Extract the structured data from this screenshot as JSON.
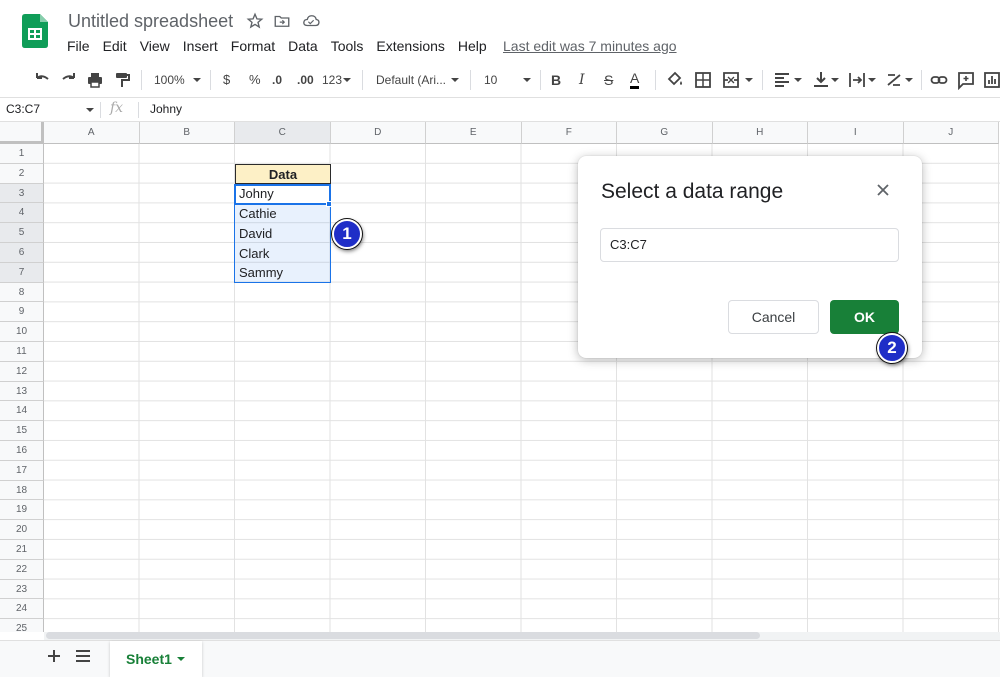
{
  "doc": {
    "title": "Untitled spreadsheet",
    "last_edit": "Last edit was 7 minutes ago"
  },
  "menu": [
    "File",
    "Edit",
    "View",
    "Insert",
    "Format",
    "Data",
    "Tools",
    "Extensions",
    "Help"
  ],
  "toolbar": {
    "zoom": "100%",
    "currency": "$",
    "percent": "%",
    "dec_decrease": ".0",
    "dec_increase": ".00",
    "more_formats": "123",
    "font": "Default (Ari...",
    "font_size": "10",
    "bold": "B",
    "italic": "I",
    "strike": "S",
    "text_color": "A"
  },
  "formula_bar": {
    "name_box": "C3:C7",
    "fx": "fx",
    "value": "Johny"
  },
  "grid": {
    "columns": [
      "A",
      "B",
      "C",
      "D",
      "E",
      "F",
      "G",
      "H",
      "I",
      "J"
    ],
    "rows": [
      "1",
      "2",
      "3",
      "4",
      "5",
      "6",
      "7",
      "8",
      "9",
      "10",
      "11",
      "12",
      "13",
      "14",
      "15",
      "16",
      "17",
      "18",
      "19",
      "20",
      "21",
      "22",
      "23",
      "24",
      "25"
    ],
    "header_cell": "Data",
    "cells": [
      "Johny",
      "Cathie",
      "David",
      "Clark",
      "Sammy"
    ]
  },
  "dialog": {
    "title": "Select a data range",
    "range": "C3:C7",
    "cancel": "Cancel",
    "ok": "OK"
  },
  "callouts": [
    "1",
    "2"
  ],
  "sheets": {
    "active": "Sheet1"
  },
  "colors": {
    "accent_green": "#188038",
    "selection_blue": "#1a73e8",
    "header_fill": "#fdf0c6",
    "callout": "#1f2ec7"
  }
}
